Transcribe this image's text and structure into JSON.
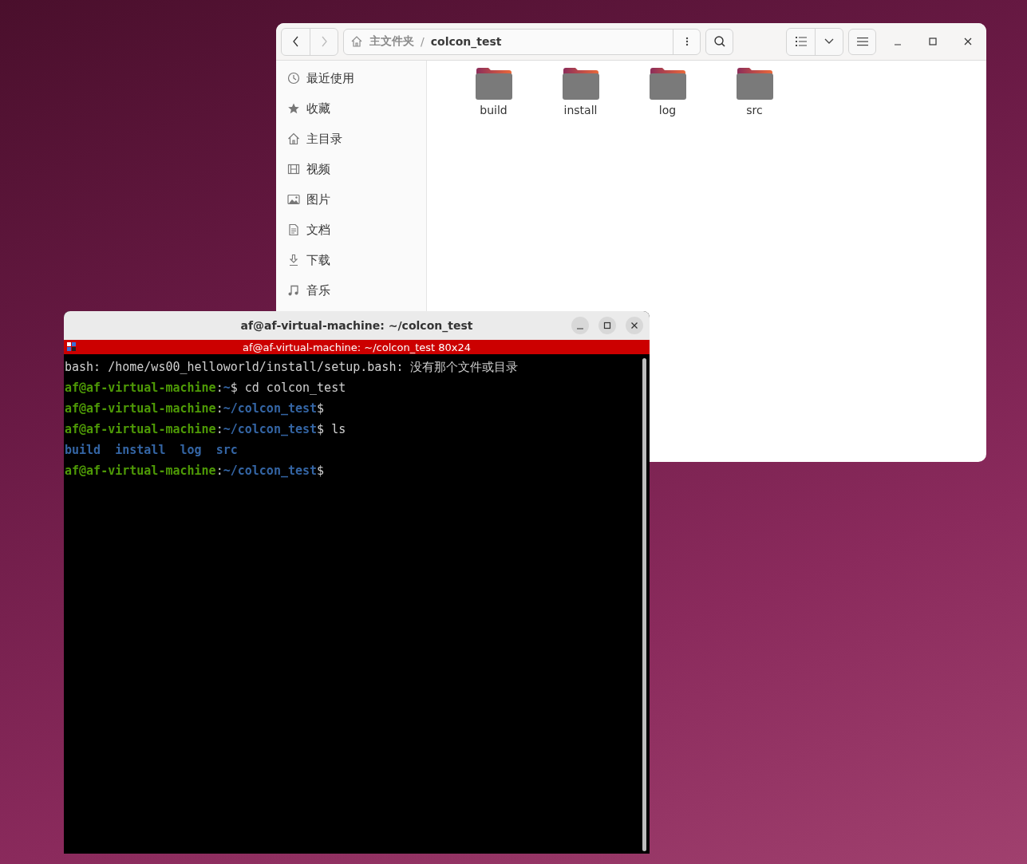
{
  "file_manager": {
    "nav": [
      {
        "kind": "back",
        "disabled": false
      },
      {
        "kind": "forward",
        "disabled": true
      }
    ],
    "path_separator": "/",
    "breadcrumbs": [
      {
        "label": "主文件夹",
        "kind": "home",
        "selected": false
      },
      {
        "label": "colcon_test",
        "kind": "folder",
        "selected": true
      }
    ],
    "sidebar": {
      "items": [
        {
          "label": "最近使用",
          "kind": "recent"
        },
        {
          "label": "收藏",
          "kind": "starred"
        },
        {
          "label": "主目录",
          "kind": "home"
        },
        {
          "label": "视频",
          "kind": "videos"
        },
        {
          "label": "图片",
          "kind": "pictures"
        },
        {
          "label": "文档",
          "kind": "documents"
        },
        {
          "label": "下载",
          "kind": "downloads"
        },
        {
          "label": "音乐",
          "kind": "music"
        }
      ]
    },
    "files": [
      {
        "name": "build"
      },
      {
        "name": "install"
      },
      {
        "name": "log"
      },
      {
        "name": "src"
      }
    ]
  },
  "terminal": {
    "window_title": "af@af-virtual-machine: ~/colcon_test",
    "banner": "af@af-virtual-machine: ~/colcon_test 80x24",
    "lines": [
      [
        {
          "kind": "plain",
          "text": "bash: /home/ws00_helloworld/install/setup.bash: 没有那个文件或目录"
        }
      ],
      [
        {
          "kind": "user",
          "text": "af@af-virtual-machine"
        },
        {
          "kind": "plain",
          "text": ":"
        },
        {
          "kind": "path",
          "text": "~"
        },
        {
          "kind": "plain",
          "text": "$ cd colcon_test"
        }
      ],
      [
        {
          "kind": "user",
          "text": "af@af-virtual-machine"
        },
        {
          "kind": "plain",
          "text": ":"
        },
        {
          "kind": "path",
          "text": "~/colcon_test"
        },
        {
          "kind": "plain",
          "text": "$"
        }
      ],
      [
        {
          "kind": "user",
          "text": "af@af-virtual-machine"
        },
        {
          "kind": "plain",
          "text": ":"
        },
        {
          "kind": "path",
          "text": "~/colcon_test"
        },
        {
          "kind": "plain",
          "text": "$ ls"
        }
      ],
      [
        {
          "kind": "dir",
          "text": "build  install  log  src"
        }
      ],
      [
        {
          "kind": "user",
          "text": "af@af-virtual-machine"
        },
        {
          "kind": "plain",
          "text": ":"
        },
        {
          "kind": "path",
          "text": "~/colcon_test"
        },
        {
          "kind": "plain",
          "text": "$"
        }
      ]
    ]
  }
}
